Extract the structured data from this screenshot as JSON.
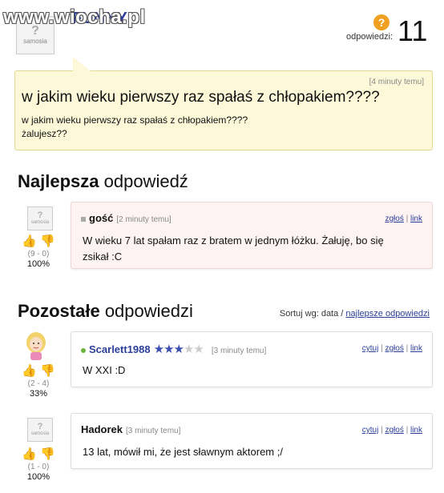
{
  "header": {
    "watermark": "www.wiocha.pl",
    "username": "FUNNY",
    "avatar_text": "samosia",
    "answers_label": "odpowiedzi:",
    "answers_count": "11",
    "question_icon": "?"
  },
  "question": {
    "time": "[4 minuty temu]",
    "title": "w jakim wieku pierwszy raz spałaś z chłopakiem????",
    "body_line1": "w jakim wieku pierwszy raz spałaś z chłopakiem????",
    "body_line2": "żalujesz??"
  },
  "best": {
    "heading_bold": "Najlepsza",
    "heading_rest": " odpowiedź",
    "author": "gość",
    "time": "[2 minuty temu]",
    "link_report": "zgłoś",
    "link_link": "link",
    "text_line1": "W wieku 7 lat spałam raz z bratem w jednym łóżku. Żałuję, bo się",
    "text_line2": "zsikał :C",
    "score": "(9 - 0)",
    "pct": "100%"
  },
  "others": {
    "heading_bold": "Pozostałe",
    "heading_rest": " odpowiedzi",
    "sort_label": "Sortuj wg: data /",
    "sort_link": "najlepsze odpowiedzi"
  },
  "answers": [
    {
      "author": "Scarlett1988",
      "time": "[3 minuty temu]",
      "link_quote": "cytuj",
      "link_report": "zgłoś",
      "link_link": "link",
      "text": "W XXI :D",
      "score": "(2 - 4)",
      "pct": "33%",
      "stars_on": "★★★",
      "stars_off": "★★"
    },
    {
      "author": "Hadorek",
      "time": "[3 minuty temu]",
      "link_quote": "cytuj",
      "link_report": "zgłoś",
      "link_link": "link",
      "text": "13 lat, mówił mi, że jest sławnym aktorem ;/",
      "score": "(1 - 0)",
      "pct": "100%"
    }
  ],
  "colors": {
    "link": "#2b3f9a",
    "question_bg": "#fdf9d8",
    "best_bg": "#fdf3f3",
    "thumb_up": "#c04aa0",
    "thumb_down": "#d4a020"
  },
  "icons": [
    "question-mark-icon",
    "thumb-up-icon",
    "thumb-down-icon",
    "star-icon",
    "status-dot-icon"
  ]
}
